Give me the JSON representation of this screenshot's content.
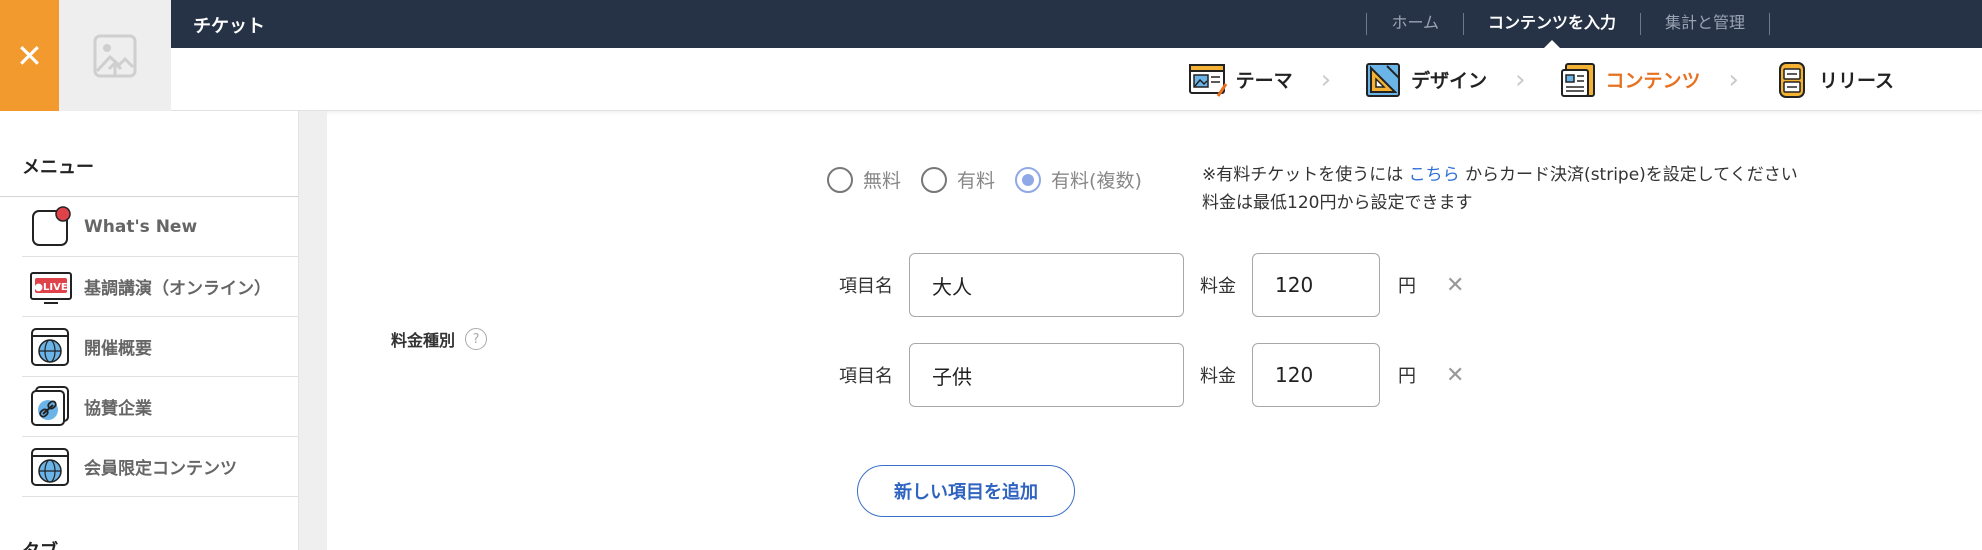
{
  "header": {
    "app_title": "チケット",
    "nav": [
      {
        "label": "ホーム",
        "active": false
      },
      {
        "label": "コンテンツを入力",
        "active": true
      },
      {
        "label": "集計と管理",
        "active": false
      }
    ]
  },
  "steps": [
    {
      "label": "テーマ",
      "icon": "theme-icon",
      "current": false
    },
    {
      "label": "デザイン",
      "icon": "design-icon",
      "current": false
    },
    {
      "label": "コンテンツ",
      "icon": "content-icon",
      "current": true
    },
    {
      "label": "リリース",
      "icon": "release-icon",
      "current": false
    }
  ],
  "sidebar": {
    "menu_title": "メニュー",
    "items": [
      {
        "label": "What's New",
        "icon": "notification-icon"
      },
      {
        "label": "基調講演（オンライン）",
        "icon": "live-icon"
      },
      {
        "label": "開催概要",
        "icon": "globe-icon"
      },
      {
        "label": "協賛企業",
        "icon": "link-icon"
      },
      {
        "label": "会員限定コンテンツ",
        "icon": "globe-icon"
      }
    ],
    "tab_title": "タブ"
  },
  "form": {
    "row_label": "料金種別",
    "radios": [
      {
        "label": "無料",
        "selected": false
      },
      {
        "label": "有料",
        "selected": false
      },
      {
        "label": "有料(複数)",
        "selected": true
      }
    ],
    "note_prefix": "※有料チケットを使うには",
    "note_link": "こちら",
    "note_suffix": "からカード決済(stripe)を設定してください",
    "note_line2": "料金は最低120円から設定できます",
    "item_label": "項目名",
    "fee_label": "料金",
    "yen_label": "円",
    "price_items": [
      {
        "name": "大人",
        "fee": "120"
      },
      {
        "name": "子供",
        "fee": "120"
      }
    ],
    "add_button": "新しい項目を追加"
  },
  "colors": {
    "topbar": "#263347",
    "accent_orange": "#F39A2E",
    "current_step": "#E8711F",
    "link_blue": "#2f6fd6"
  }
}
